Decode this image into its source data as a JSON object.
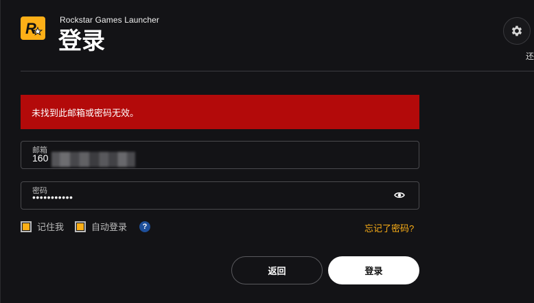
{
  "header": {
    "app_name": "Rockstar Games Launcher",
    "page_title": "登录",
    "settings_partial_label": "还"
  },
  "error": {
    "message": "未找到此邮箱或密码无效。"
  },
  "form": {
    "email": {
      "label": "邮箱",
      "value": "160"
    },
    "password": {
      "label": "密码",
      "masked_value": "•••••••••••"
    },
    "remember_me_label": "记住我",
    "auto_login_label": "自动登录",
    "help_glyph": "?",
    "forgot_password_label": "忘记了密码?"
  },
  "buttons": {
    "back_label": "返回",
    "login_label": "登录"
  },
  "colors": {
    "accent": "#fcaf17",
    "error": "#b30a0a",
    "background": "#131316",
    "help": "#1e4f9a"
  },
  "icons": {
    "logo": "rockstar-logo-icon",
    "settings": "gear-icon",
    "password_toggle": "eye-icon",
    "help": "help-icon"
  }
}
